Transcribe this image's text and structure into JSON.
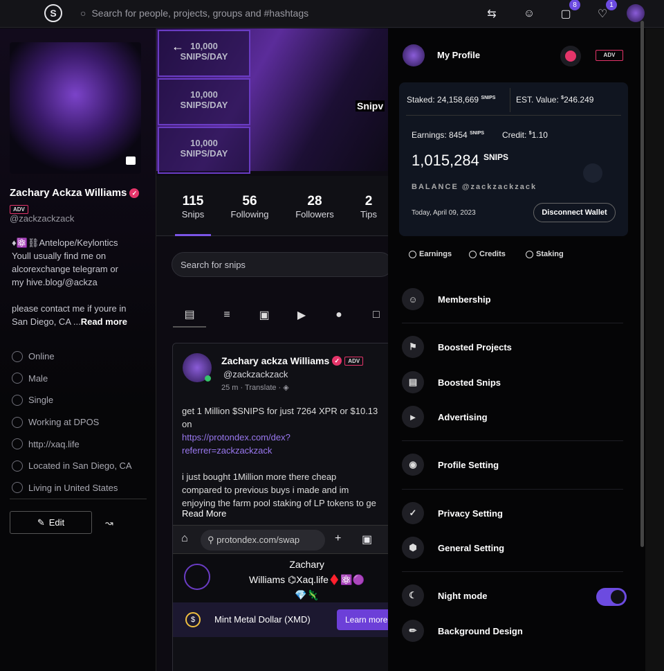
{
  "topbar": {
    "logo": "S",
    "search_placeholder": "Search for people, projects, groups and #hashtags",
    "icons": [
      "swap-icon",
      "friends-icon",
      "messages-icon",
      "notifications-icon"
    ],
    "messages_badge": "8",
    "notifications_badge": "1"
  },
  "sidebar": {
    "name": "Zachary Ackza Williams",
    "adv": "ADV",
    "handle": "@zackzackzack",
    "bio": "♦⚛️⛓Antelope/Keylontics\nYoull usually find me on\nalcorexchange telegram or\nmy hive.blog/@ackza\n\nplease contact me if youre in\nSan Diego, CA ...",
    "read_more": "Read more",
    "facts": [
      "Online",
      "Male",
      "Single",
      "Working at DPOS",
      "http://xaq.life",
      "Located in San Diego, CA",
      "Living in United States"
    ],
    "edit_label": "Edit"
  },
  "cover": {
    "cells": [
      "10,000\nSNIPS/DAY",
      "10,000\nSNIPS/DAY",
      "10,000\nSNIPS/DAY"
    ],
    "label": "Snipv"
  },
  "stats": [
    {
      "n": "115",
      "l": "Snips"
    },
    {
      "n": "56",
      "l": "Following"
    },
    {
      "n": "28",
      "l": "Followers"
    },
    {
      "n": "2",
      "l": "Tips"
    }
  ],
  "search_snips": "Search for snips",
  "post": {
    "name": "Zachary ackza Williams",
    "adv": "ADV",
    "handle": "@zackzackzack",
    "time": "25 m",
    "translate": "Translate",
    "text1": "get 1 Million $SNIPS for just 7264 XPR or $10.13 on",
    "link": "https://protondex.com/dex?\nreferrer=zackzackzack",
    "text2": "i just bought 1Million more there cheap\ncompared to previous buys i made and im\nenjoying the farm pool staking of LP tokens to ge",
    "read_more": "Read More",
    "url": "protondex.com/swap",
    "embed_name": "Zachary\nWilliams ⌬Xaq.life♦️⚛️🟣\n💎🦎",
    "mint_text": "Mint Metal Dollar (XMD)",
    "mint_btn": "Learn more"
  },
  "panel": {
    "my_profile": "My Profile",
    "adv": "ADV",
    "staked_label": "Staked: 24,158,669",
    "staked_unit": "SNIPS",
    "est_label": "EST. Value:",
    "est_currency": "$",
    "est_value": "246.249",
    "earnings_label": "Earnings: 8454",
    "earnings_unit": "SNIPS",
    "credit_label": "Credit:",
    "credit_currency": "$",
    "credit_value": "1.10",
    "balance": "1,015,284",
    "balance_unit": "SNIPS",
    "balance_label": "BALANCE @zackzackzack",
    "date": "Today, April 09, 2023",
    "disconnect": "Disconnect Wallet",
    "subtabs": [
      "Earnings",
      "Credits",
      "Staking"
    ],
    "menu": [
      "Membership",
      "Boosted Projects",
      "Boosted Snips",
      "Advertising",
      "Profile Setting",
      "Privacy Setting",
      "General Setting",
      "Night mode",
      "Background Design"
    ],
    "night_mode_on": true
  }
}
